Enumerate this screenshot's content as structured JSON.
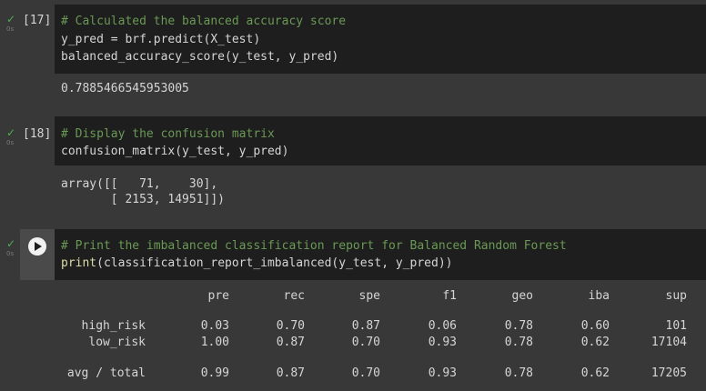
{
  "cells": [
    {
      "exec_count": "[17]",
      "duration": "0s",
      "status": "success",
      "code": {
        "comment": "# Calculated the balanced accuracy score",
        "line2": "y_pred = brf.predict(X_test)",
        "line3": "balanced_accuracy_score(y_test, y_pred)"
      },
      "output": "0.7885466545953005"
    },
    {
      "exec_count": "[18]",
      "duration": "0s",
      "status": "success",
      "code": {
        "comment": "# Display the confusion matrix",
        "line2": "confusion_matrix(y_test, y_pred)"
      },
      "output": {
        "line1": "array([[   71,    30],",
        "line2": "       [ 2153, 14951]])"
      }
    },
    {
      "exec_count": "",
      "duration": "0s",
      "status": "success",
      "code": {
        "comment": "# Print the imbalanced classification report for Balanced Random Forest",
        "fn": "print",
        "rest": "(classification_report_imbalanced(y_test, y_pred))"
      },
      "report": {
        "headers": [
          "pre",
          "rec",
          "spe",
          "f1",
          "geo",
          "iba",
          "sup"
        ],
        "rows": [
          {
            "label": "high_risk",
            "values": [
              "0.03",
              "0.70",
              "0.87",
              "0.06",
              "0.78",
              "0.60",
              "101"
            ]
          },
          {
            "label": "low_risk",
            "values": [
              "1.00",
              "0.87",
              "0.70",
              "0.93",
              "0.78",
              "0.62",
              "17104"
            ]
          }
        ],
        "total": {
          "label": "avg / total",
          "values": [
            "0.99",
            "0.87",
            "0.70",
            "0.93",
            "0.78",
            "0.62",
            "17205"
          ]
        }
      }
    }
  ],
  "icons": {
    "check": "checkmark-icon",
    "play": "play-icon"
  },
  "colors": {
    "background": "#383838",
    "code_background": "#1e1e1e",
    "comment": "#6a9955",
    "success": "#4caf50",
    "function": "#dcdcaa"
  }
}
